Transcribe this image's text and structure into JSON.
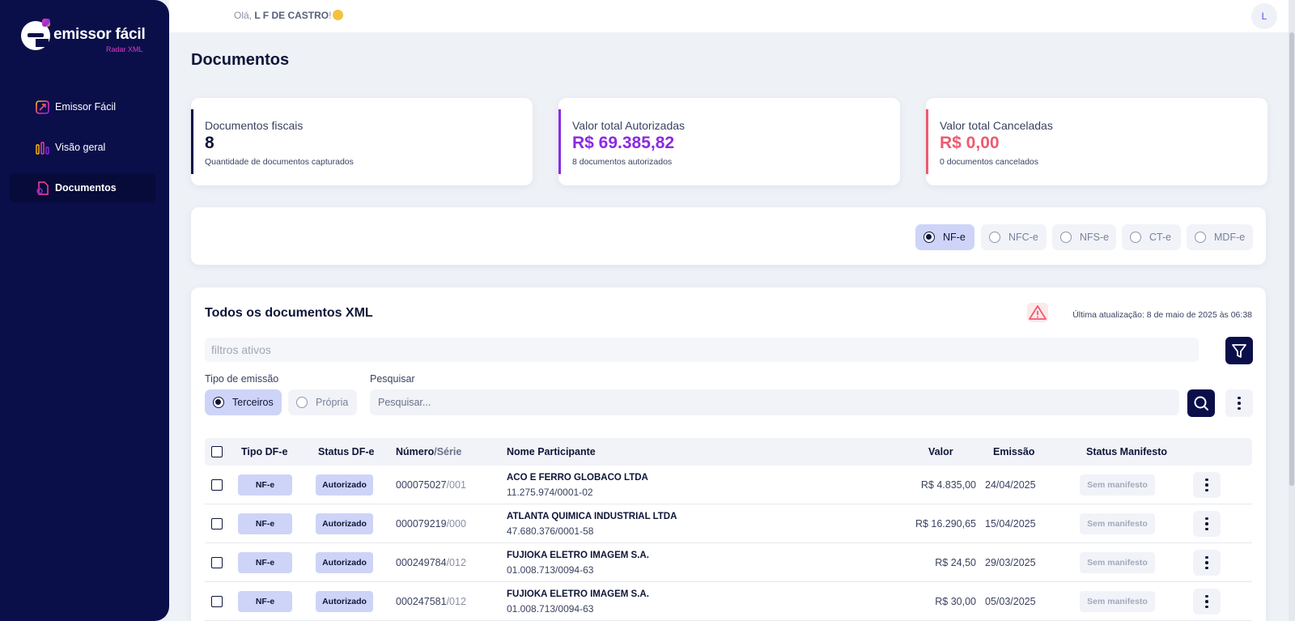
{
  "brand": {
    "name": "emissor fácil",
    "subtitle": "Radar XML"
  },
  "nav": [
    {
      "label": "Emissor Fácil",
      "icon": "external-link-icon"
    },
    {
      "label": "Visão geral",
      "icon": "bar-chart-icon"
    },
    {
      "label": "Documentos",
      "icon": "document-icon",
      "active": true
    }
  ],
  "topbar": {
    "greeting": "Olá,",
    "user": "L F DE CASTRO",
    "exclaim": "!",
    "avatar_initial": "L"
  },
  "page": {
    "title": "Documentos"
  },
  "stats": [
    {
      "label": "Documentos fiscais",
      "value": "8",
      "sub": "Quantidade de documentos capturados",
      "color": "#0a0f4a"
    },
    {
      "label": "Valor total Autorizadas",
      "value": "R$ 69.385,82",
      "sub": "8 documentos autorizados",
      "color": "#8a2be2"
    },
    {
      "label": "Valor total Canceladas",
      "value": "R$ 0,00",
      "sub": "0 documentos cancelados",
      "color": "#ee5a6f"
    }
  ],
  "doc_types": [
    {
      "label": "NF-e",
      "selected": true
    },
    {
      "label": "NFC-e",
      "selected": false
    },
    {
      "label": "NFS-e",
      "selected": false
    },
    {
      "label": "CT-e",
      "selected": false
    },
    {
      "label": "MDF-e",
      "selected": false
    }
  ],
  "list": {
    "title": "Todos os documentos XML",
    "last_update": "Última atualização: 8 de maio de 2025 às 06:38",
    "active_filters": "filtros ativos",
    "emission_label": "Tipo de emissão",
    "emission_options": [
      {
        "label": "Terceiros",
        "selected": true
      },
      {
        "label": "Própria",
        "selected": false
      }
    ],
    "search_label": "Pesquisar",
    "search_placeholder": "Pesquisar..."
  },
  "table": {
    "headers": {
      "tipo": "Tipo DF-e",
      "status": "Status DF-e",
      "numero": "Número",
      "numero_sep": "/Série",
      "participante": "Nome Participante",
      "valor": "Valor",
      "emissao": "Emissão",
      "manifesto": "Status Manifesto"
    },
    "rows": [
      {
        "tipo": "NF-e",
        "status": "Autorizado",
        "numero": "000075027",
        "serie": "/001",
        "nome": "ACO E FERRO GLOBACO LTDA",
        "cnpj": "11.275.974/0001-02",
        "valor": "R$ 4.835,00",
        "emissao": "24/04/2025",
        "manifesto": "Sem manifesto"
      },
      {
        "tipo": "NF-e",
        "status": "Autorizado",
        "numero": "000079219",
        "serie": "/000",
        "nome": "ATLANTA QUIMICA INDUSTRIAL LTDA",
        "cnpj": "47.680.376/0001-58",
        "valor": "R$ 16.290,65",
        "emissao": "15/04/2025",
        "manifesto": "Sem manifesto"
      },
      {
        "tipo": "NF-e",
        "status": "Autorizado",
        "numero": "000249784",
        "serie": "/012",
        "nome": "FUJIOKA ELETRO IMAGEM S.A.",
        "cnpj": "01.008.713/0094-63",
        "valor": "R$ 24,50",
        "emissao": "29/03/2025",
        "manifesto": "Sem manifesto"
      },
      {
        "tipo": "NF-e",
        "status": "Autorizado",
        "numero": "000247581",
        "serie": "/012",
        "nome": "FUJIOKA ELETRO IMAGEM S.A.",
        "cnpj": "01.008.713/0094-63",
        "valor": "R$ 30,00",
        "emissao": "05/03/2025",
        "manifesto": "Sem manifesto"
      }
    ]
  }
}
